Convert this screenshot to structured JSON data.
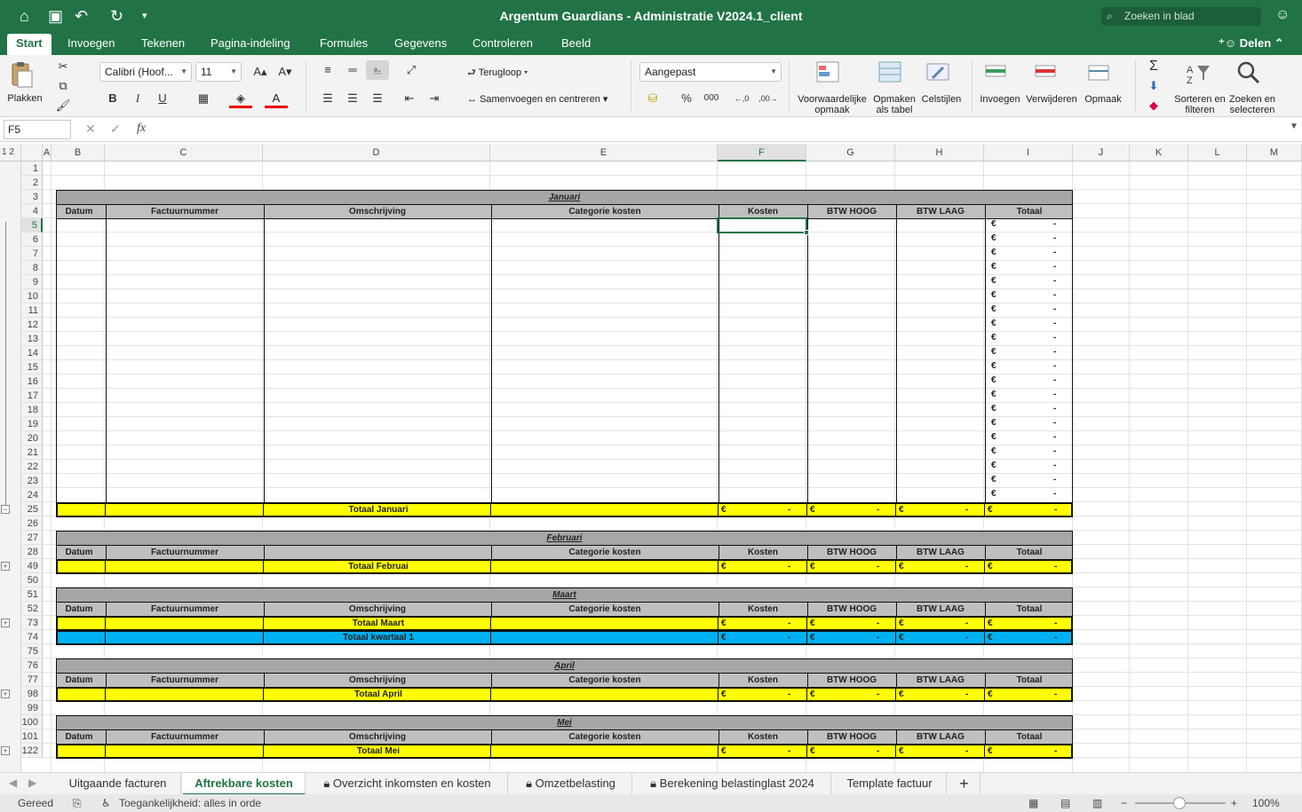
{
  "window": {
    "title": "Argentum Guardians - Administratie V2024.1_client",
    "search_placeholder": "Zoeken in blad"
  },
  "ribbon_tabs": [
    "Start",
    "Invoegen",
    "Tekenen",
    "Pagina-indeling",
    "Formules",
    "Gegevens",
    "Controleren",
    "Beeld"
  ],
  "share_label": "Delen",
  "ribbon": {
    "paste": "Plakken",
    "font_name": "Calibri (Hoof...",
    "font_size": "11",
    "wrap": "Terugloop",
    "merge": "Samenvoegen en centreren",
    "number_format": "Aangepast",
    "conditional": "Voorwaardelijke opmaak",
    "format_table": "Opmaken als tabel",
    "cell_styles": "Celstijlen",
    "insert": "Invoegen",
    "delete": "Verwijderen",
    "format": "Opmaak",
    "sort": "Sorteren en filteren",
    "find": "Zoeken en selecteren",
    "bold": "B",
    "italic": "I",
    "underline": "U",
    "percent": "%",
    "thousands": "000"
  },
  "formula_bar": {
    "cell_ref": "F5",
    "fx": "fx",
    "value": ""
  },
  "outline_levels": [
    "1",
    "2"
  ],
  "columns": [
    "A",
    "B",
    "C",
    "D",
    "E",
    "F",
    "G",
    "H",
    "I",
    "J",
    "K",
    "L",
    "M"
  ],
  "selected_column": "F",
  "selected_row": "5",
  "rows": [
    "1",
    "2",
    "3",
    "4",
    "5",
    "6",
    "7",
    "8",
    "9",
    "10",
    "11",
    "12",
    "13",
    "14",
    "15",
    "16",
    "17",
    "18",
    "19",
    "20",
    "21",
    "22",
    "23",
    "24",
    "25",
    "26",
    "27",
    "28",
    "49",
    "50",
    "51",
    "52",
    "73",
    "74",
    "75",
    "76",
    "77",
    "98",
    "99",
    "100",
    "101",
    "122"
  ],
  "headers": {
    "datum": "Datum",
    "factuurnummer": "Factuurnummer",
    "omschrijving": "Omschrijving",
    "categorie": "Categorie kosten",
    "kosten": "Kosten",
    "btw_hoog": "BTW HOOG",
    "btw_laag": "BTW LAAG",
    "totaal": "Totaal"
  },
  "months": {
    "januari": "Januari",
    "februari": "Februari",
    "maart": "Maart",
    "april": "April",
    "mei": "Mei"
  },
  "totals": {
    "januari": "Totaal Januari",
    "februari": "Totaal Februai",
    "maart": "Totaal Maart",
    "kwartaal1": "Totaal kwartaal 1",
    "april": "Totaal April",
    "mei": "Totaal Mei"
  },
  "currency": {
    "symbol": "€",
    "empty": "-"
  },
  "sheet_tabs": [
    "Uitgaande facturen",
    "Aftrekbare kosten",
    "Overzicht inkomsten en kosten",
    "Omzetbelasting",
    "Berekening belastinglast 2024",
    "Template factuur"
  ],
  "active_sheet": "Aftrekbare kosten",
  "status": {
    "ready": "Gereed",
    "accessibility": "Toegankelijkheid: alles in orde",
    "zoom": "100%"
  },
  "colors": {
    "accent": "#217346",
    "header_gray": "#bfbfbf",
    "month_gray": "#a6a6a6",
    "total_yellow": "#ffff00",
    "quarter_blue": "#00b0f0"
  }
}
